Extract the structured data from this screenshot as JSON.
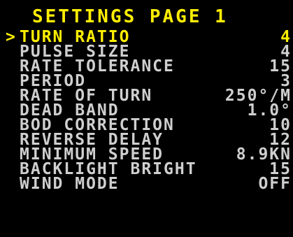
{
  "title": "SETTINGS PAGE 1",
  "cursor_glyph": ">",
  "colors": {
    "background": "#000000",
    "title": "#ffee00",
    "selected": "#ffee00",
    "item": "#cfcfcf"
  },
  "items": [
    {
      "label": "TURN RATIO",
      "value": "4",
      "selected": true
    },
    {
      "label": "PULSE SIZE",
      "value": "4",
      "selected": false
    },
    {
      "label": "RATE TOLERANCE",
      "value": "15",
      "selected": false
    },
    {
      "label": "PERIOD",
      "value": "3",
      "selected": false
    },
    {
      "label": "RATE OF TURN",
      "value": "250°/M",
      "selected": false
    },
    {
      "label": "DEAD BAND",
      "value": "1.0°",
      "selected": false
    },
    {
      "label": "BOD CORRECTION",
      "value": "10",
      "selected": false
    },
    {
      "label": "REVERSE DELAY",
      "value": "12",
      "selected": false
    },
    {
      "label": "MINIMUM SPEED",
      "value": "8.9KN",
      "selected": false
    },
    {
      "label": "BACKLIGHT BRIGHT",
      "value": "15",
      "selected": false
    },
    {
      "label": "WIND MODE",
      "value": "OFF",
      "selected": false
    }
  ]
}
